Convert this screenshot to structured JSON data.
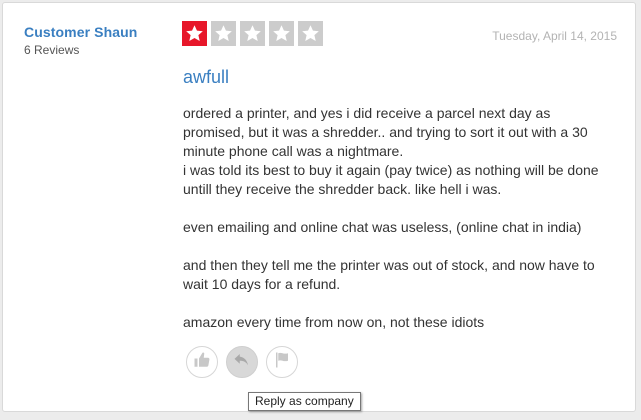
{
  "reviewer": {
    "name": "Customer Shaun",
    "review_count": "6 Reviews"
  },
  "rating": {
    "value": 1,
    "max": 5,
    "filled_color": "#e7172a",
    "empty_color": "#cccccc"
  },
  "review": {
    "date": "Tuesday, April 14, 2015",
    "title": "awfull",
    "paragraphs": [
      "ordered a printer, and yes i did receive a parcel next day as promised, but it was a shredder.. and trying to sort it out with a 30 minute phone call was a nightmare.",
      "i was told its best to buy it again (pay twice) as nothing will be done untill they receive the shredder back. like hell i was.",
      "even emailing and online chat was useless, (online chat in india)",
      "and then they tell me the printer was out of stock, and now have to wait 10 days for a refund.",
      "amazon every time from now on, not these idiots"
    ]
  },
  "actions": {
    "like_icon": "thumbs-up-icon",
    "reply_icon": "reply-arrow-icon",
    "flag_icon": "flag-icon"
  },
  "tooltip": {
    "text": "Reply as company"
  }
}
